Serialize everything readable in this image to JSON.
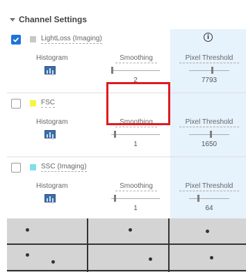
{
  "section": {
    "title": "Channel Settings"
  },
  "column_info_icon": "info-icon",
  "channels": [
    {
      "name": "LightLoss (Imaging)",
      "checked": true,
      "swatch_color": "#c8c8c8",
      "histogram_label": "Histogram",
      "smoothing_label": "Smoothing",
      "smoothing_value": "2",
      "threshold_label": "Pixel Threshold",
      "threshold_value": "7793"
    },
    {
      "name": "FSC",
      "checked": false,
      "swatch_color": "#f5f542",
      "histogram_label": "Histogram",
      "smoothing_label": "Smoothing",
      "smoothing_value": "1",
      "threshold_label": "Pixel Threshold",
      "threshold_value": "1650"
    },
    {
      "name": "SSC (Imaging)",
      "checked": false,
      "swatch_color": "#7fe0e8",
      "histogram_label": "Histogram",
      "smoothing_label": "Smoothing",
      "smoothing_value": "1",
      "threshold_label": "Pixel Threshold",
      "threshold_value": "64"
    }
  ]
}
